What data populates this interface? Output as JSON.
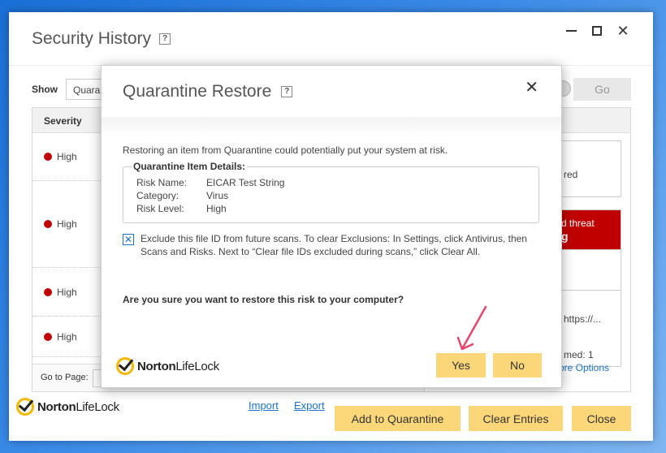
{
  "window": {
    "title": "Security History",
    "help": "?",
    "controls": {
      "minimize": "minimize",
      "maximize": "maximize",
      "close": "✕"
    }
  },
  "filter": {
    "show_label": "Show",
    "show_value": "Quarantine",
    "go_label": "Go"
  },
  "table": {
    "columns": [
      "Severity"
    ],
    "rows": [
      {
        "severity": "High"
      },
      {
        "severity": "High"
      },
      {
        "severity": "High"
      },
      {
        "severity": "High"
      }
    ],
    "goto_label": "Go to Page:"
  },
  "details": {
    "snippets": [
      "red",
      "d threat",
      "g",
      "https://...",
      "med: 1"
    ],
    "more_options": "More Options"
  },
  "footer": {
    "brand_bold": "Norton",
    "brand_rest": "LifeLock",
    "import": "Import",
    "export": "Export",
    "add_to_quarantine": "Add to Quarantine",
    "clear_entries": "Clear Entries",
    "close": "Close"
  },
  "dialog": {
    "title": "Quarantine Restore",
    "help": "?",
    "close": "✕",
    "warning": "Restoring an item from Quarantine could potentially put your system at risk.",
    "details_legend": "Quarantine Item Details:",
    "details": [
      {
        "key": "Risk Name:",
        "value": "EICAR Test String"
      },
      {
        "key": "Category:",
        "value": "Virus"
      },
      {
        "key": "Risk Level:",
        "value": "High"
      }
    ],
    "exclude_checked": true,
    "exclude_text": "Exclude this file ID from future scans. To clear Exclusions: In Settings, click Antivirus, then Scans and Risks. Next to “Clear file IDs excluded during scans,” click Clear All.",
    "question": "Are you sure you want to restore this risk to your computer?",
    "brand_bold": "Norton",
    "brand_rest": "LifeLock",
    "yes": "Yes",
    "no": "No"
  },
  "colors": {
    "accent_button": "#fcd77a",
    "link": "#1a73c8",
    "severity_high": "#c00000",
    "annotation_arrow": "#e8456a"
  }
}
